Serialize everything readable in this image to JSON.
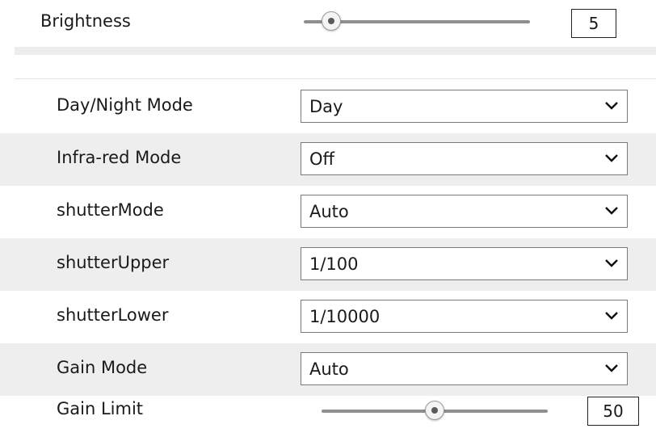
{
  "brightness": {
    "label": "Brightness",
    "value": "5",
    "level_fraction": 0.12
  },
  "settings": [
    {
      "label": "Day/Night Mode",
      "value": "Day"
    },
    {
      "label": "Infra-red Mode",
      "value": "Off"
    },
    {
      "label": "shutterMode",
      "value": "Auto"
    },
    {
      "label": "shutterUpper",
      "value": "1/100"
    },
    {
      "label": "shutterLower",
      "value": "1/10000"
    },
    {
      "label": "Gain Mode",
      "value": "Auto"
    }
  ],
  "gain_limit": {
    "label": "Gain Limit",
    "value": "50",
    "level_fraction": 0.5
  },
  "icons": {
    "slider_thumb": "slider-thumb",
    "dropdown": "chevron-down-icon"
  },
  "colors": {
    "alt_row_bg": "#eeeeee",
    "track": "#8f8f8f"
  }
}
